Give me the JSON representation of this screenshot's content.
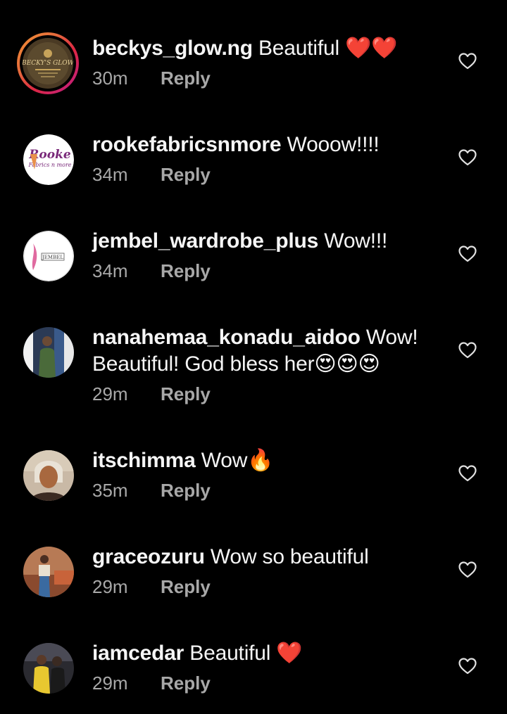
{
  "comments": [
    {
      "username": "beckys_glow.ng",
      "text": "Beautiful ❤️❤️",
      "time": "30m",
      "reply_label": "Reply",
      "avatar_text": "BECKY'S GLOW"
    },
    {
      "username": "rookefabricsnmore",
      "text": "Wooow!!!!",
      "time": "34m",
      "reply_label": "Reply",
      "avatar_text": "Rooke Fabrics n more"
    },
    {
      "username": "jembel_wardrobe_plus",
      "text": "Wow!!!",
      "time": "34m",
      "reply_label": "Reply",
      "avatar_text": "JEMBEL"
    },
    {
      "username": "nanahemaa_konadu_aidoo",
      "text": "Wow! Beautiful! God bless her😍😍😍",
      "time": "29m",
      "reply_label": "Reply"
    },
    {
      "username": "itschimma",
      "text": "Wow🔥",
      "time": "35m",
      "reply_label": "Reply"
    },
    {
      "username": "graceozuru",
      "text": "Wow so beautiful",
      "time": "29m",
      "reply_label": "Reply"
    },
    {
      "username": "iamcedar",
      "text": "Beautiful ❤️",
      "time": "29m",
      "reply_label": "Reply"
    }
  ],
  "colors": {
    "background": "#000000",
    "text": "#f5f5f5",
    "secondary": "#a8a8a8"
  },
  "icons": {
    "like": "heart-outline-icon"
  }
}
